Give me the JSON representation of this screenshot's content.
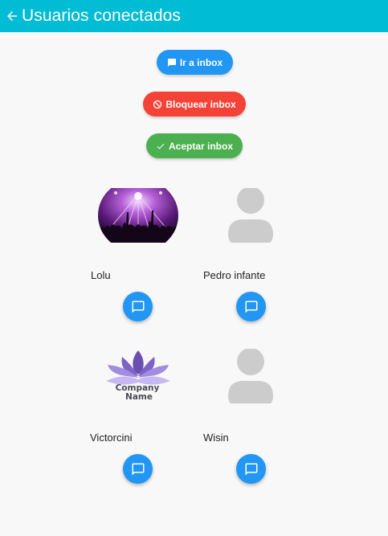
{
  "header": {
    "title": "Usuarios conectados",
    "back_icon": "arrow-left-icon",
    "background": "#00bcd4"
  },
  "actions": {
    "go_inbox": {
      "label": "Ir a inbox",
      "icon": "message-icon",
      "color": "#2196f3"
    },
    "block_inbox": {
      "label": "Bloquear inbox",
      "icon": "block-icon",
      "color": "#f44336"
    },
    "accept_inbox": {
      "label": "Aceptar inbox",
      "icon": "check-icon",
      "color": "#4caf50"
    }
  },
  "users": [
    {
      "name": "Lolu",
      "avatar": "concert-photo"
    },
    {
      "name": "Pedro infante",
      "avatar": "default-person-icon"
    },
    {
      "name": "Victorcini",
      "avatar": "company-logo"
    },
    {
      "name": "Wisin",
      "avatar": "default-person-icon"
    }
  ],
  "company_logo_text": [
    "Company",
    "Name"
  ],
  "chat_button_icon": "chat-bubble-icon"
}
